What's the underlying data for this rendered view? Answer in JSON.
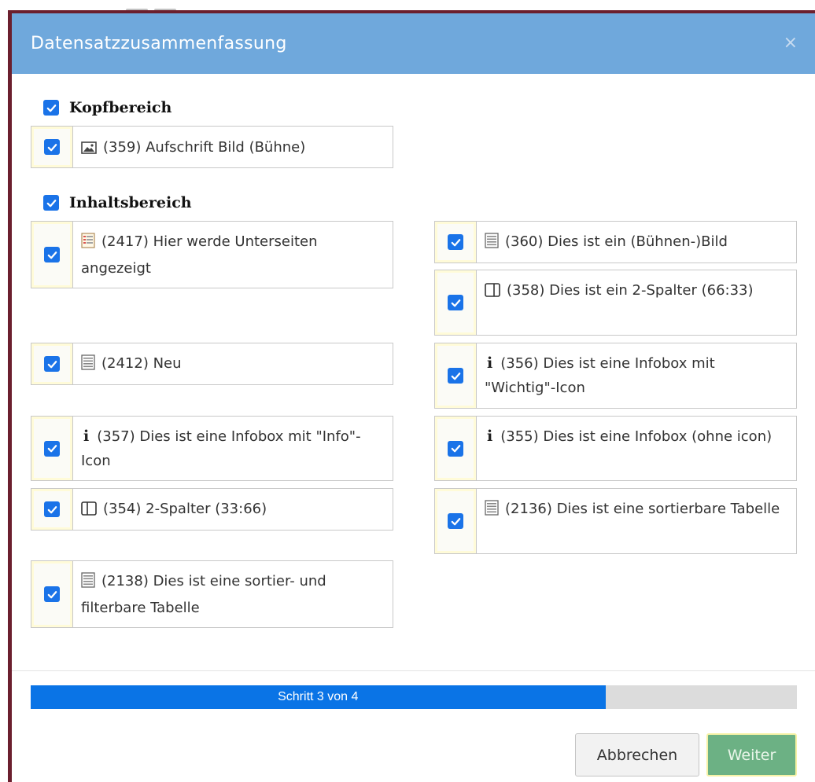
{
  "dialog": {
    "title": "Datensatzzusammenfassung",
    "close_label": "×"
  },
  "sections": {
    "header": {
      "label": "Kopfbereich",
      "checked": true
    },
    "content": {
      "label": "Inhaltsbereich",
      "checked": true
    }
  },
  "items": {
    "header_1": {
      "label": "(359) Aufschrift Bild (Bühne)",
      "icon": "image-icon",
      "checked": true
    },
    "left_1": {
      "label": "(2417) Hier werde Unterseiten angezeigt",
      "icon": "page-list-icon",
      "checked": true
    },
    "left_2": {
      "label": "(2412) Neu",
      "icon": "text-block-icon",
      "checked": true
    },
    "left_3": {
      "label": "(357) Dies ist eine Infobox mit \"Info\"-Icon",
      "icon": "info-icon",
      "checked": true
    },
    "left_4": {
      "label": "(354) 2-Spalter (33:66)",
      "icon": "two-column-icon",
      "checked": true
    },
    "left_5": {
      "label": "(2138) Dies ist eine sortier- und filterbare Tabelle",
      "icon": "text-block-icon",
      "checked": true
    },
    "right_1": {
      "label": "(360) Dies ist ein (Bühnen-)Bild",
      "icon": "text-block-icon",
      "checked": true
    },
    "right_2": {
      "label": "(358) Dies ist ein 2-Spalter (66:33)",
      "icon": "two-column-icon",
      "checked": true
    },
    "right_3": {
      "label": "(356) Dies ist eine Infobox mit \"Wichtig\"-Icon",
      "icon": "info-icon",
      "checked": true
    },
    "right_4": {
      "label": "(355) Dies ist eine Infobox (ohne icon)",
      "icon": "info-icon",
      "checked": true
    },
    "right_5": {
      "label": "(2136) Dies ist eine sortierbare Tabelle",
      "icon": "text-block-icon",
      "checked": true
    }
  },
  "progress": {
    "label": "Schritt 3 von 4",
    "current_step": 3,
    "total_steps": 4,
    "fill_fraction": 0.75
  },
  "buttons": {
    "cancel": "Abbrechen",
    "next": "Weiter"
  },
  "colors": {
    "header_bg": "#6fa8dc",
    "checkbox": "#1a73e8",
    "progress_fill": "#0a74e6",
    "next_button": "#6cb184",
    "frame": "#6b1f2e"
  }
}
